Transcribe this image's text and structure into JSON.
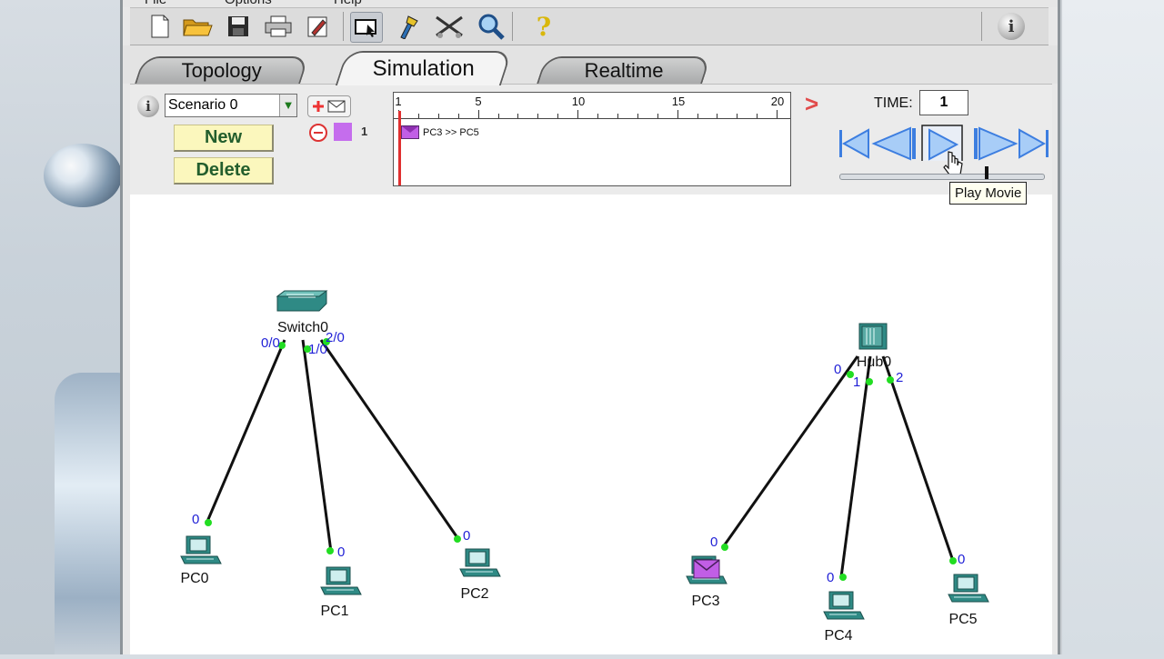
{
  "menu": [
    "File",
    "Options",
    "Help"
  ],
  "toolbar": {
    "icons": [
      "new-file-icon",
      "open-folder-icon",
      "save-icon",
      "print-icon",
      "activity-wizard-icon",
      "select-icon",
      "inspect-icon",
      "delete-icon",
      "zoom-icon",
      "help-icon",
      "info-icon"
    ]
  },
  "tabs": {
    "topology": "Topology",
    "simulation": "Simulation",
    "realtime": "Realtime"
  },
  "scenario": {
    "selected": "Scenario 0",
    "new_label": "New",
    "delete_label": "Delete",
    "pdu_count": "1"
  },
  "timeline": {
    "ticks": [
      "1",
      "5",
      "10",
      "15",
      "20"
    ],
    "event": "PC3 >> PC5"
  },
  "time": {
    "label": "TIME:",
    "value": "1"
  },
  "tooltip": "Play Movie",
  "topology": {
    "devices": {
      "switch0": "Switch0",
      "hub0": "Hub0",
      "pc0": "PC0",
      "pc1": "PC1",
      "pc2": "PC2",
      "pc3": "PC3",
      "pc4": "PC4",
      "pc5": "PC5"
    },
    "ports": {
      "sw_p1": "0/0",
      "sw_p2": "1/0",
      "sw_p3": "2/0",
      "hub_p0": "0",
      "hub_p1": "1",
      "hub_p2": "2",
      "pc0": "0",
      "pc1": "0",
      "pc2": "0",
      "pc3": "0",
      "pc4": "0",
      "pc5": "0"
    }
  },
  "colors": {
    "link": "#111111",
    "port_dot": "#22dd22",
    "port_label": "#1f1fd6",
    "pdu": "#c15ee6",
    "device": "#2f8a85"
  }
}
